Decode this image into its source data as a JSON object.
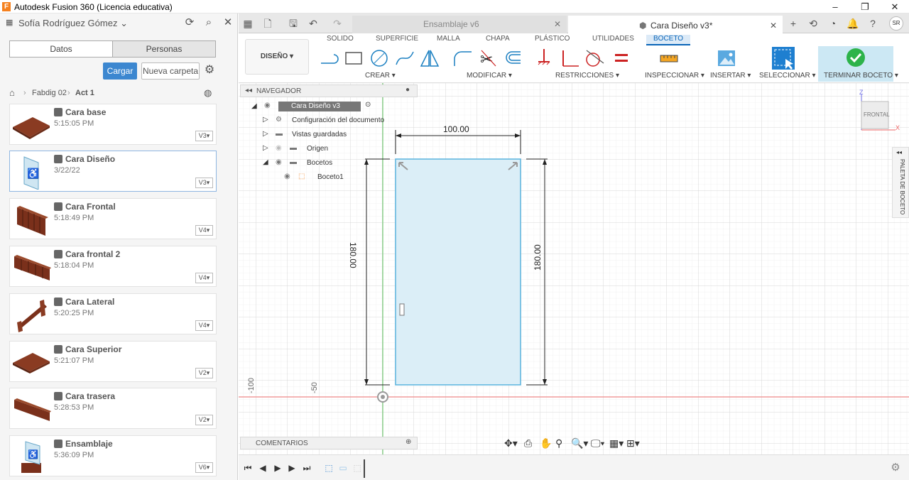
{
  "window": {
    "title": "Autodesk Fusion 360 (Licencia educativa)",
    "logo_letter": "F"
  },
  "left_panel": {
    "user_name": "Sofía Rodríguez Gómez",
    "tabs": [
      "Datos",
      "Personas"
    ],
    "upload_label": "Cargar",
    "new_folder_label": "Nueva carpeta",
    "breadcrumb": [
      "Fabdig 02",
      "Act 1"
    ],
    "files": [
      {
        "name": "Cara base",
        "date": "5:15:05 PM",
        "version": "V3"
      },
      {
        "name": "Cara Diseño",
        "date": "3/22/22",
        "version": "V3"
      },
      {
        "name": "Cara Frontal",
        "date": "5:18:49 PM",
        "version": "V4"
      },
      {
        "name": "Cara frontal 2",
        "date": "5:18:04 PM",
        "version": "V4"
      },
      {
        "name": "Cara Lateral",
        "date": "5:20:25 PM",
        "version": "V4"
      },
      {
        "name": "Cara Superior",
        "date": "5:21:07 PM",
        "version": "V2"
      },
      {
        "name": "Cara trasera",
        "date": "5:28:53 PM",
        "version": "V2"
      },
      {
        "name": "Ensamblaje",
        "date": "5:36:09 PM",
        "version": "V6"
      }
    ]
  },
  "doc_tabs": [
    {
      "label": "Ensamblaje v6",
      "active": false
    },
    {
      "label": "Cara Diseño v3*",
      "active": true
    }
  ],
  "user_initials": "SR",
  "ribbon": {
    "workspace_button": "DISEÑO",
    "tabs": [
      "SOLIDO",
      "SUPERFICIE",
      "MALLA",
      "CHAPA",
      "PLÁSTICO",
      "UTILIDADES",
      "BOCETO"
    ],
    "groups": [
      "CREAR",
      "MODIFICAR",
      "RESTRICCIONES",
      "INSPECCIONAR",
      "INSERTAR",
      "SELECCIONAR",
      "TERMINAR BOCETO"
    ]
  },
  "browser": {
    "header": "NAVEGADOR",
    "root": "Cara Diseño v3",
    "items": [
      "Configuración del documento",
      "Vistas guardadas",
      "Origen",
      "Bocetos",
      "Boceto1"
    ]
  },
  "comments_label": "COMENTARIOS",
  "canvas": {
    "dim_width": "100.00",
    "dim_height_left": "180.00",
    "dim_height_right": "180.00",
    "axis_label_1": "-100",
    "axis_label_2": "-50"
  },
  "viewcube": {
    "face": "FRONTAL",
    "z_label": "Z",
    "x_label": "X"
  },
  "palette_label": "PALETA DE BOCETO",
  "colors": {
    "accent": "#0a65b8",
    "upload_btn": "#3c87d0",
    "sketch_fill": "#dbeef7",
    "sketch_stroke": "#5ab4de",
    "finish_bg": "#cce8f4",
    "finish_check": "#2db34a"
  }
}
